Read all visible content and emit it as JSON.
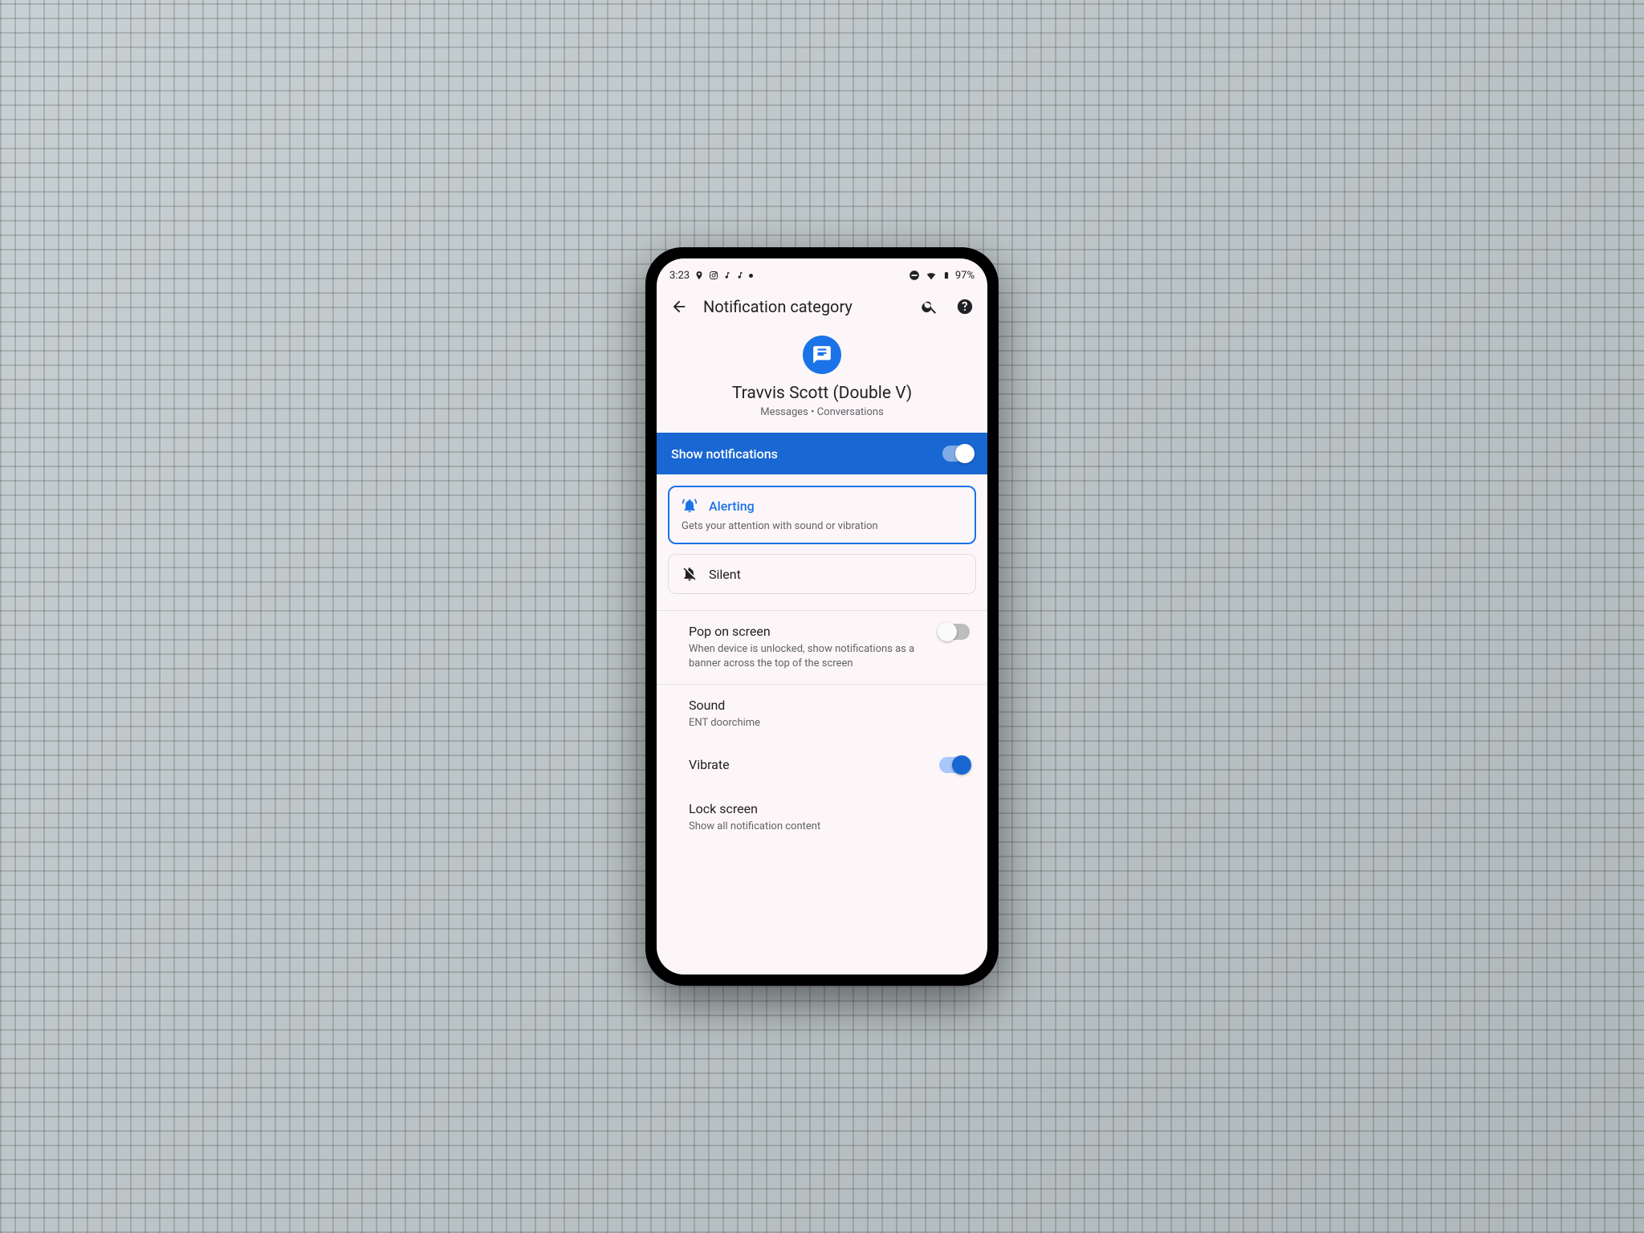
{
  "statusbar": {
    "time": "3:23",
    "battery": "97%"
  },
  "appbar": {
    "title": "Notification category"
  },
  "header": {
    "contact_name": "Travvis Scott (Double V)",
    "contact_sub": "Messages • Conversations"
  },
  "banner": {
    "label": "Show notifications",
    "enabled": true
  },
  "options": {
    "alerting": {
      "title": "Alerting",
      "desc": "Gets your attention with sound or vibration",
      "selected": true
    },
    "silent": {
      "title": "Silent",
      "selected": false
    }
  },
  "settings": {
    "pop": {
      "title": "Pop on screen",
      "sub": "When device is unlocked, show notifications as a banner across the top of the screen",
      "enabled": false
    },
    "sound": {
      "title": "Sound",
      "sub": "ENT doorchime"
    },
    "vibrate": {
      "title": "Vibrate",
      "enabled": true
    },
    "lockscreen": {
      "title": "Lock screen",
      "sub": "Show all notification content"
    }
  }
}
